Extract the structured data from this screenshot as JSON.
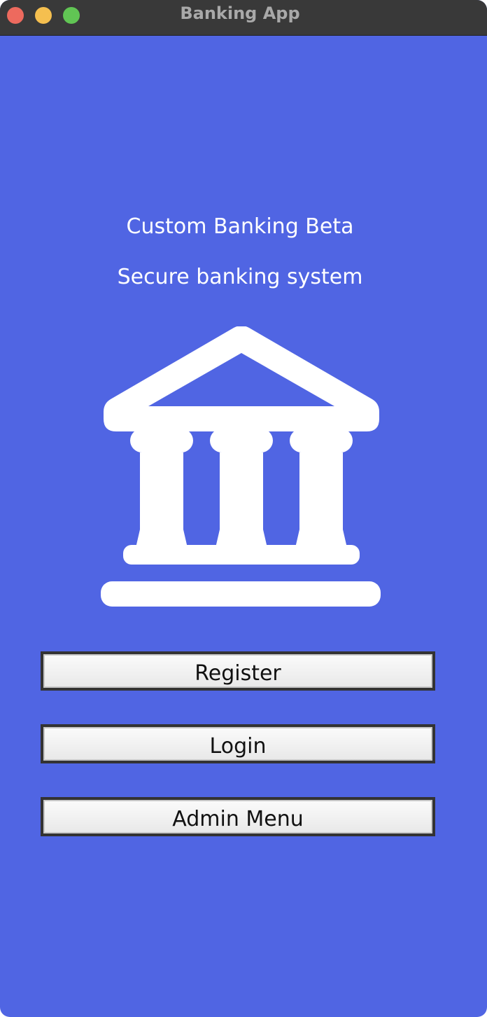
{
  "window": {
    "title": "Banking App",
    "background_color": "#5065e3"
  },
  "main": {
    "title": "Custom Banking Beta",
    "subtitle": "Secure banking system",
    "icon": "bank-icon"
  },
  "buttons": [
    {
      "label": "Register"
    },
    {
      "label": "Login"
    },
    {
      "label": "Admin Menu"
    }
  ]
}
